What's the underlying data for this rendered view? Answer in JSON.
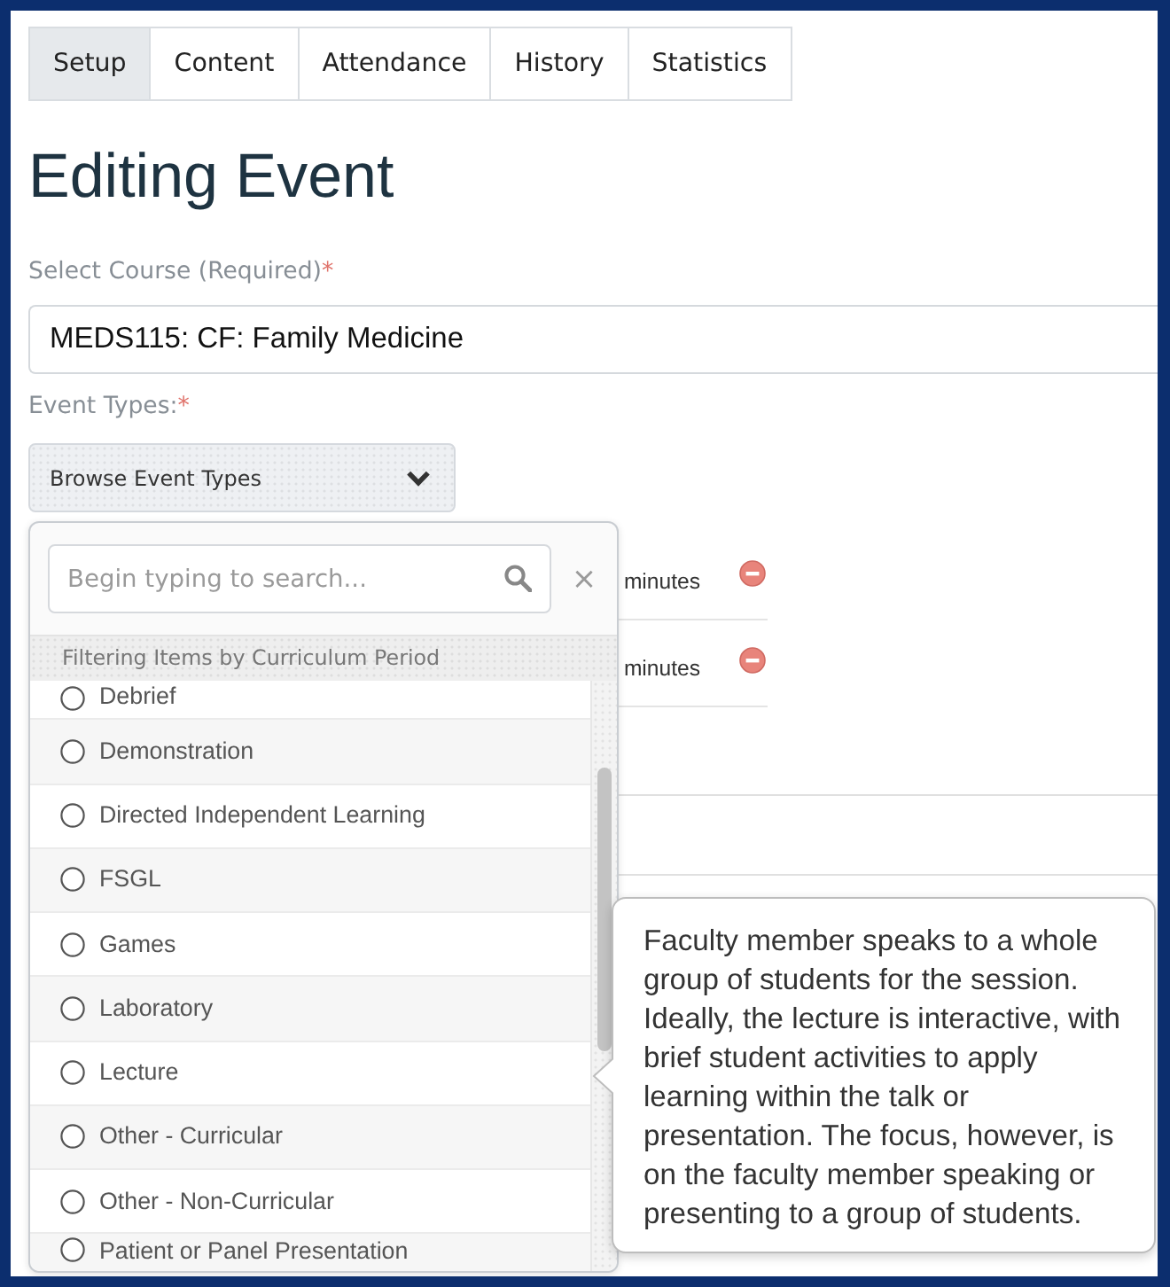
{
  "tabs": [
    {
      "label": "Setup",
      "selected": true
    },
    {
      "label": "Content",
      "selected": false
    },
    {
      "label": "Attendance",
      "selected": false
    },
    {
      "label": "History",
      "selected": false
    },
    {
      "label": "Statistics",
      "selected": false
    }
  ],
  "page_title": "Editing Event",
  "course": {
    "label": "Select Course (Required)",
    "required_mark": "*",
    "value": "MEDS115: CF: Family Medicine"
  },
  "event_types": {
    "label": "Event Types:",
    "required_mark": "*",
    "browse_button": "Browse Event Types",
    "selected_rows": [
      {
        "unit": "minutes"
      },
      {
        "unit": "minutes"
      }
    ],
    "dropdown": {
      "search": {
        "placeholder": "Begin typing to search..."
      },
      "clear_symbol": "×",
      "filter_note": "Filtering Items by Curriculum Period",
      "items": [
        {
          "label": "Debrief",
          "selected": false
        },
        {
          "label": "Demonstration",
          "selected": false
        },
        {
          "label": "Directed Independent Learning",
          "selected": false
        },
        {
          "label": "FSGL",
          "selected": false
        },
        {
          "label": "Games",
          "selected": false
        },
        {
          "label": "Laboratory",
          "selected": false
        },
        {
          "label": "Lecture",
          "selected": false,
          "tooltip": "Faculty member speaks to a whole group of students for the session. Ideally, the lecture is interactive, with brief student activities to apply learning within the talk or presentation. The focus, however, is on the faculty member speaking or presenting to a group of students."
        },
        {
          "label": "Other - Curricular",
          "selected": false
        },
        {
          "label": "Other - Non-Curricular",
          "selected": false
        },
        {
          "label": "Patient or Panel Presentation",
          "selected": false
        }
      ]
    }
  }
}
